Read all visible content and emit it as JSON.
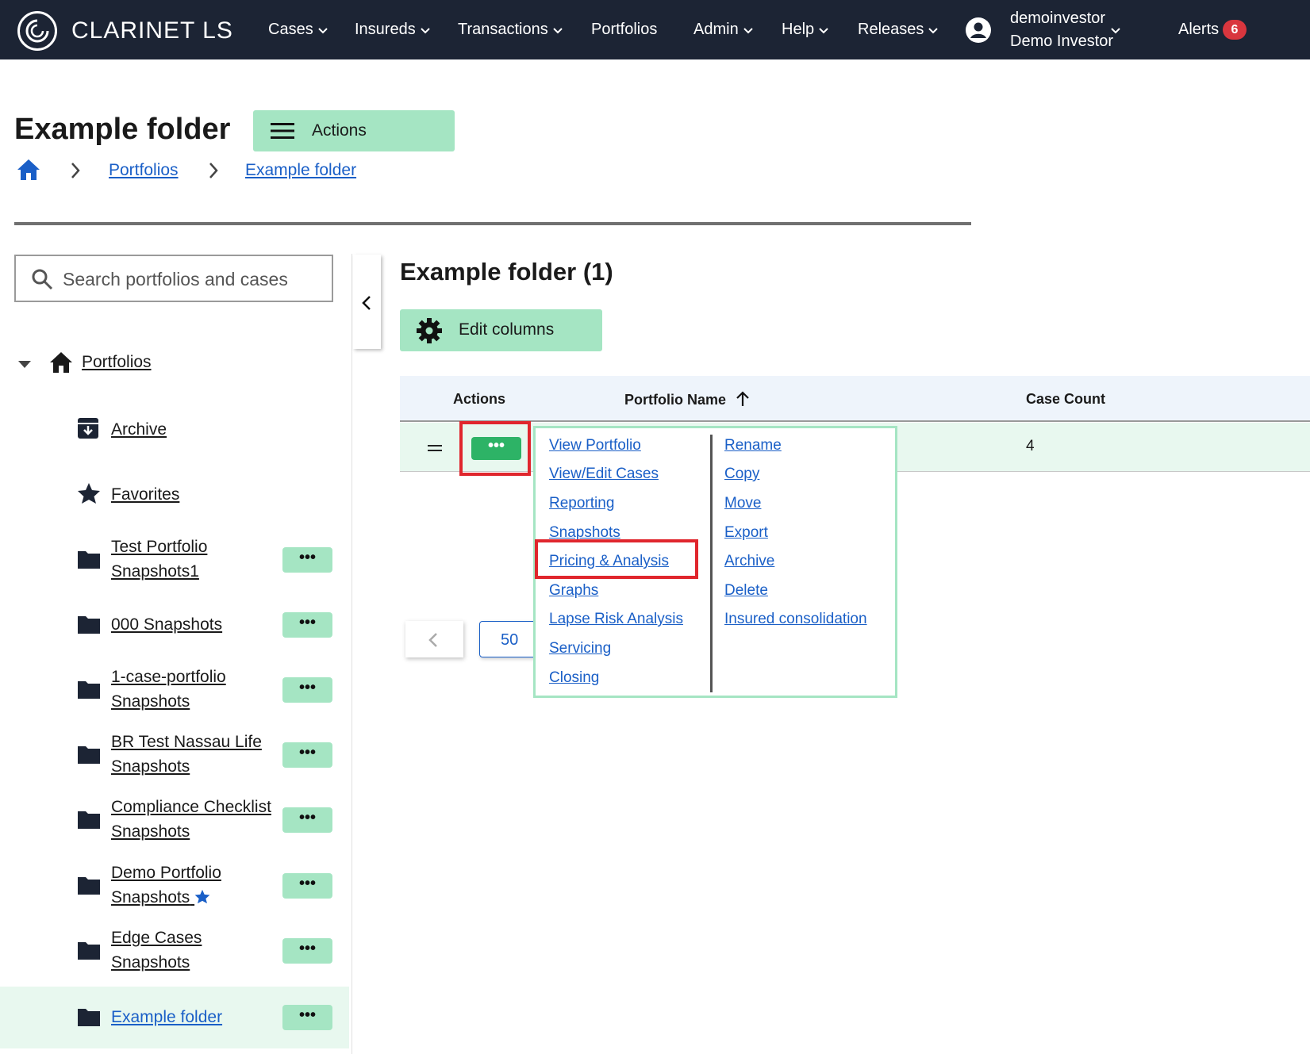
{
  "nav": {
    "brand": "CLARINET LS",
    "items": [
      "Cases",
      "Insureds",
      "Transactions",
      "Portfolios",
      "Admin",
      "Help",
      "Releases"
    ],
    "username": "demoinvestor",
    "fullname": "Demo Investor",
    "alerts_label": "Alerts",
    "alerts_count": "6"
  },
  "header": {
    "title": "Example folder",
    "actions_label": "Actions",
    "breadcrumb": [
      "Portfolios",
      "Example folder"
    ]
  },
  "sidebar": {
    "search_placeholder": "Search portfolios and cases",
    "root_label": "Portfolios",
    "items": [
      {
        "label": "Archive",
        "icon": "archive-icon"
      },
      {
        "label": "Favorites",
        "icon": "star-icon"
      },
      {
        "label": "Test Portfolio Snapshots1",
        "icon": "folder-icon",
        "menu": "•••"
      },
      {
        "label": "000 Snapshots",
        "icon": "folder-icon",
        "menu": "•••"
      },
      {
        "label": "1-case-portfolio Snapshots",
        "icon": "folder-icon",
        "menu": "•••"
      },
      {
        "label": "BR Test Nassau Life Snapshots",
        "icon": "folder-icon",
        "menu": "•••"
      },
      {
        "label": "Compliance Checklist Snapshots",
        "icon": "folder-icon",
        "menu": "•••"
      },
      {
        "label": "Demo Portfolio Snapshots",
        "icon": "folder-icon",
        "menu": "•••",
        "favorite": true
      },
      {
        "label": "Edge Cases Snapshots",
        "icon": "folder-icon",
        "menu": "•••"
      },
      {
        "label": "Example folder",
        "icon": "folder-icon",
        "menu": "•••",
        "selected": true
      }
    ]
  },
  "main": {
    "title": "Example folder (1)",
    "edit_columns_label": "Edit columns",
    "columns": [
      "Actions",
      "Portfolio Name",
      "Case Count"
    ],
    "rows": [
      {
        "actions": "•••",
        "case_count": "4"
      }
    ],
    "page_size": "50"
  },
  "menu": {
    "left": [
      "View Portfolio",
      "View/Edit Cases",
      "Reporting",
      "Snapshots",
      "Pricing & Analysis",
      "Graphs",
      "Lapse Risk Analysis",
      "Servicing",
      "Closing"
    ],
    "right": [
      "Rename",
      "Copy",
      "Move",
      "Export",
      "Archive",
      "Delete",
      "Insured consolidation"
    ]
  },
  "colors": {
    "navbar": "#1c2434",
    "accent_green": "#a5e5c3",
    "button_green": "#2db366",
    "link_blue": "#1a5fc7",
    "highlight_red": "#e0262d"
  }
}
